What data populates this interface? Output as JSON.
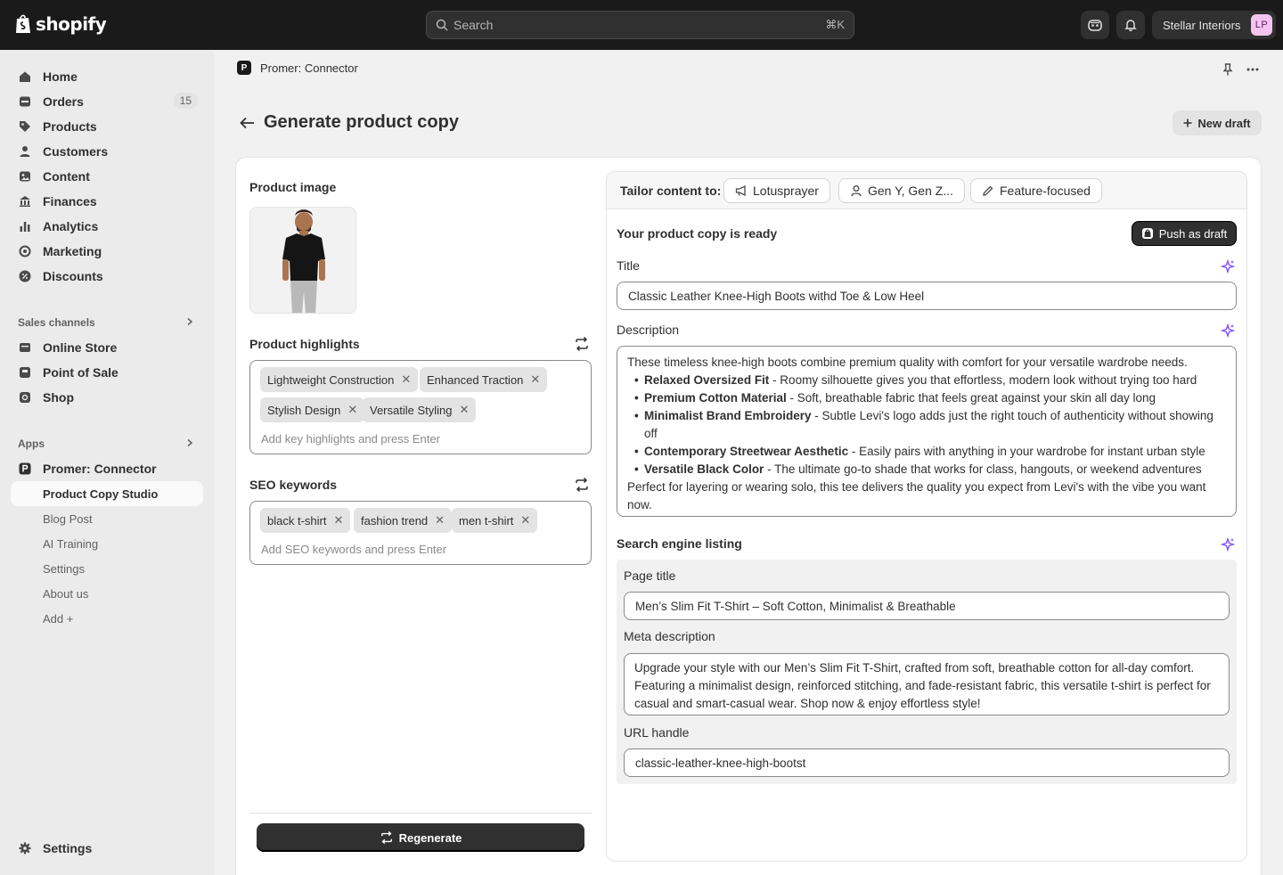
{
  "topbar": {
    "brand": "shopify",
    "search_placeholder": "Search",
    "search_shortcut": "⌘K",
    "store_name": "Stellar Interiors",
    "avatar_initials": "LP"
  },
  "sidebar": {
    "items": [
      {
        "label": "Home",
        "icon": "home-icon"
      },
      {
        "label": "Orders",
        "icon": "orders-icon",
        "badge": "15"
      },
      {
        "label": "Products",
        "icon": "tag-icon"
      },
      {
        "label": "Customers",
        "icon": "person-icon"
      },
      {
        "label": "Content",
        "icon": "content-icon"
      },
      {
        "label": "Finances",
        "icon": "bank-icon"
      },
      {
        "label": "Analytics",
        "icon": "bar-chart-icon"
      },
      {
        "label": "Marketing",
        "icon": "target-icon"
      },
      {
        "label": "Discounts",
        "icon": "discount-icon"
      }
    ],
    "sales_channels_title": "Sales channels",
    "sales_channels": [
      {
        "label": "Online Store",
        "icon": "store-icon"
      },
      {
        "label": "Point of Sale",
        "icon": "pos-icon"
      },
      {
        "label": "Shop",
        "icon": "shop-icon"
      }
    ],
    "apps_title": "Apps",
    "app_name": "Promer: Connector",
    "app_active_sub": "Product Copy Studio",
    "app_subs": [
      "Blog Post",
      "AI Training",
      "Settings",
      "About us",
      "Add +"
    ],
    "settings": "Settings"
  },
  "main": {
    "app_header": "Promer: Connector",
    "page_title": "Generate product copy",
    "new_draft": "New draft",
    "product_image_label": "Product image",
    "highlights_label": "Product highlights",
    "highlights": [
      "Lightweight Construction",
      "Enhanced Traction",
      "Stylish Design",
      "Versatile Styling"
    ],
    "highlights_placeholder": "Add key highlights and press Enter",
    "seo_label": "SEO keywords",
    "seo_keywords": [
      "black t-shirt",
      "fashion trend",
      "men t-shirt"
    ],
    "seo_placeholder": "Add SEO keywords and press Enter",
    "regenerate": "Regenerate"
  },
  "output": {
    "tailor_label": "Tailor content to:",
    "chips": [
      "Lotusprayer",
      "Gen Y, Gen Z...",
      "Feature-focused"
    ],
    "ready_title": "Your product copy is ready",
    "push_draft": "Push as draft",
    "title_label": "Title",
    "title_value": "Classic Leather Knee-High Boots withd Toe & Low Heel",
    "description_label": "Description",
    "description_intro": "These timeless knee-high boots combine premium quality with comfort for your versatile wardrobe needs.",
    "bullets": [
      {
        "bold": "Relaxed Oversized Fit",
        "text": " - Roomy silhouette gives you that effortless, modern look without trying too hard"
      },
      {
        "bold": "Premium Cotton Material",
        "text": " - Soft, breathable fabric that feels great against your skin all day long"
      },
      {
        "bold": "Minimalist Brand Embroidery",
        "text": " - Subtle Levi's logo adds just the right touch of authenticity without showing off"
      },
      {
        "bold": "Contemporary Streetwear Aesthetic",
        "text": " - Easily pairs with anything in your wardrobe for instant urban style"
      },
      {
        "bold": "Versatile Black Color",
        "text": " - The ultimate go-to shade that works for class, hangouts, or weekend adventures"
      }
    ],
    "description_outro": "Perfect for layering or wearing solo, this tee delivers the quality you expect from Levi's with the vibe you want now.",
    "seo_listing_label": "Search engine listing",
    "page_title_label": "Page title",
    "page_title_value": "Men’s Slim Fit T-Shirt – Soft Cotton, Minimalist & Breathable",
    "meta_label": "Meta description",
    "meta_value": "Upgrade your style with our Men’s Slim Fit T-Shirt, crafted from soft, breathable cotton for all-day comfort. Featuring a minimalist design, reinforced stitching, and fade-resistant fabric, this versatile t-shirt is perfect for casual and smart-casual wear. Shop now & enjoy effortless style!",
    "url_label": "URL handle",
    "url_value": "classic-leather-knee-high-bootst"
  },
  "colors": {
    "accent": "#303030",
    "sparkle": "#8051ff",
    "topbar": "#1a1a1a"
  }
}
